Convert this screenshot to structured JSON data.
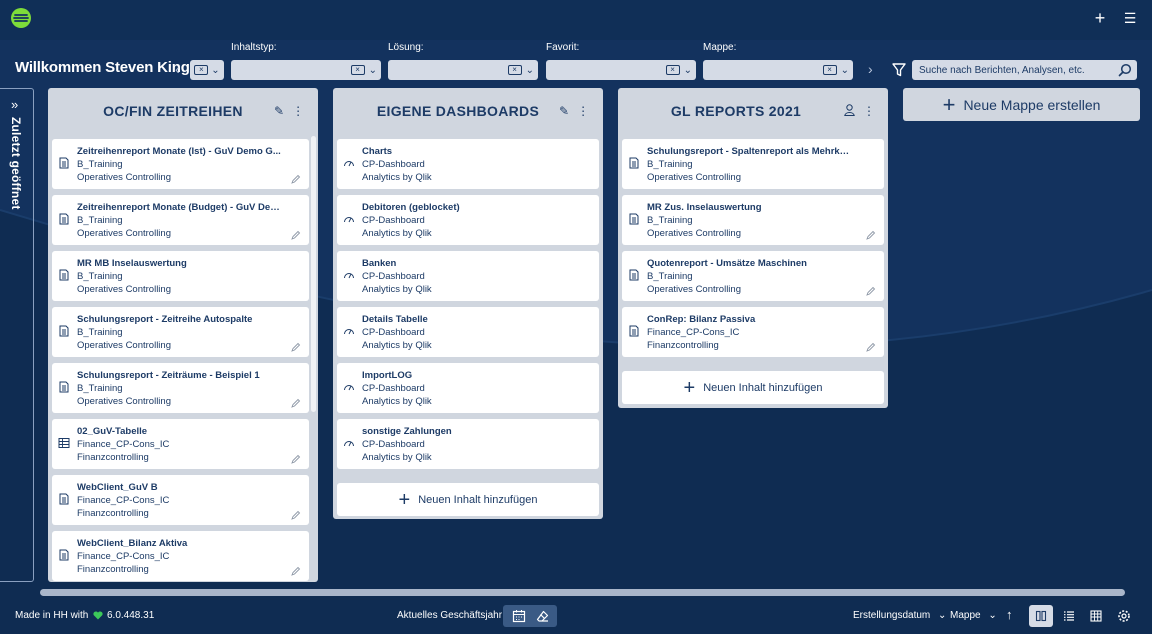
{
  "header": {
    "welcome": "Willkommen Steven King!",
    "filters": [
      {
        "label": "Inhaltstyp:"
      },
      {
        "label": "Lösung:"
      },
      {
        "label": "Favorit:"
      },
      {
        "label": "Mappe:"
      }
    ],
    "search_placeholder": "Suche nach Berichten, Analysen, etc."
  },
  "sidebar": {
    "recent_label": "Zuletzt geöffnet"
  },
  "columns": [
    {
      "title": "OC/FIN ZEITREIHEN",
      "cards": [
        {
          "title": "Zeitreihenreport Monate (Ist) - GuV Demo G...",
          "line1": "B_Training",
          "line2": "Operatives Controlling",
          "icon": "report-icon"
        },
        {
          "title": "Zeitreihenreport Monate (Budget) - GuV Dem...",
          "line1": "B_Training",
          "line2": "Operatives Controlling",
          "icon": "report-icon"
        },
        {
          "title": "MR MB Inselauswertung",
          "line1": "B_Training",
          "line2": "Operatives Controlling",
          "icon": "report-icon"
        },
        {
          "title": "Schulungsreport - Zeitreihe Autospalte",
          "line1": "B_Training",
          "line2": "Operatives Controlling",
          "icon": "report-icon"
        },
        {
          "title": "Schulungsreport - Zeiträume - Beispiel 1",
          "line1": "B_Training",
          "line2": "Operatives Controlling",
          "icon": "report-icon"
        },
        {
          "title": "02_GuV-Tabelle",
          "line1": "Finance_CP-Cons_IC",
          "line2": "Finanzcontrolling",
          "icon": "table-icon"
        },
        {
          "title": "WebClient_GuV B",
          "line1": "Finance_CP-Cons_IC",
          "line2": "Finanzcontrolling",
          "icon": "report-icon"
        },
        {
          "title": "WebClient_Bilanz Aktiva",
          "line1": "Finance_CP-Cons_IC",
          "line2": "Finanzcontrolling",
          "icon": "report-icon"
        }
      ]
    },
    {
      "title": "EIGENE DASHBOARDS",
      "cards": [
        {
          "title": "Charts",
          "line1": "CP-Dashboard",
          "line2": "Analytics by Qlik",
          "icon": "dashboard-icon"
        },
        {
          "title": "Debitoren (geblocket)",
          "line1": "CP-Dashboard",
          "line2": "Analytics by Qlik",
          "icon": "dashboard-icon"
        },
        {
          "title": "Banken",
          "line1": "CP-Dashboard",
          "line2": "Analytics by Qlik",
          "icon": "dashboard-icon"
        },
        {
          "title": "Details Tabelle",
          "line1": "CP-Dashboard",
          "line2": "Analytics by Qlik",
          "icon": "dashboard-icon"
        },
        {
          "title": "ImportLOG",
          "line1": "CP-Dashboard",
          "line2": "Analytics by Qlik",
          "icon": "dashboard-icon"
        },
        {
          "title": "sonstige Zahlungen",
          "line1": "CP-Dashboard",
          "line2": "Analytics by Qlik",
          "icon": "dashboard-icon"
        }
      ],
      "add_label": "Neuen Inhalt hinzufügen"
    },
    {
      "title": "GL REPORTS 2021",
      "cards": [
        {
          "title": "Schulungsreport - Spaltenreport als Mehrkopfr...",
          "line1": "B_Training",
          "line2": "Operatives Controlling",
          "icon": "report-icon"
        },
        {
          "title": "MR Zus. Inselauswertung",
          "line1": "B_Training",
          "line2": "Operatives Controlling",
          "icon": "report-icon"
        },
        {
          "title": "Quotenreport - Umsätze Maschinen",
          "line1": "B_Training",
          "line2": "Operatives Controlling",
          "icon": "report-icon"
        },
        {
          "title": "ConRep: Bilanz Passiva",
          "line1": "Finance_CP-Cons_IC",
          "line2": "Finanzcontrolling",
          "icon": "report-icon"
        }
      ],
      "add_label": "Neuen Inhalt hinzufügen"
    }
  ],
  "new_mappe_label": "Neue Mappe erstellen",
  "footer": {
    "made_in": "Made in HH with",
    "version": "6.0.448.31",
    "fiscal_year": "Aktuelles Geschäftsjahr",
    "sort_by": "Erstellungsdatum",
    "group_by": "Mappe"
  },
  "colors": {
    "background": "#13325e",
    "column": "#d0d6df",
    "text_dark": "#1d3b66",
    "heart": "#3cc85a"
  }
}
